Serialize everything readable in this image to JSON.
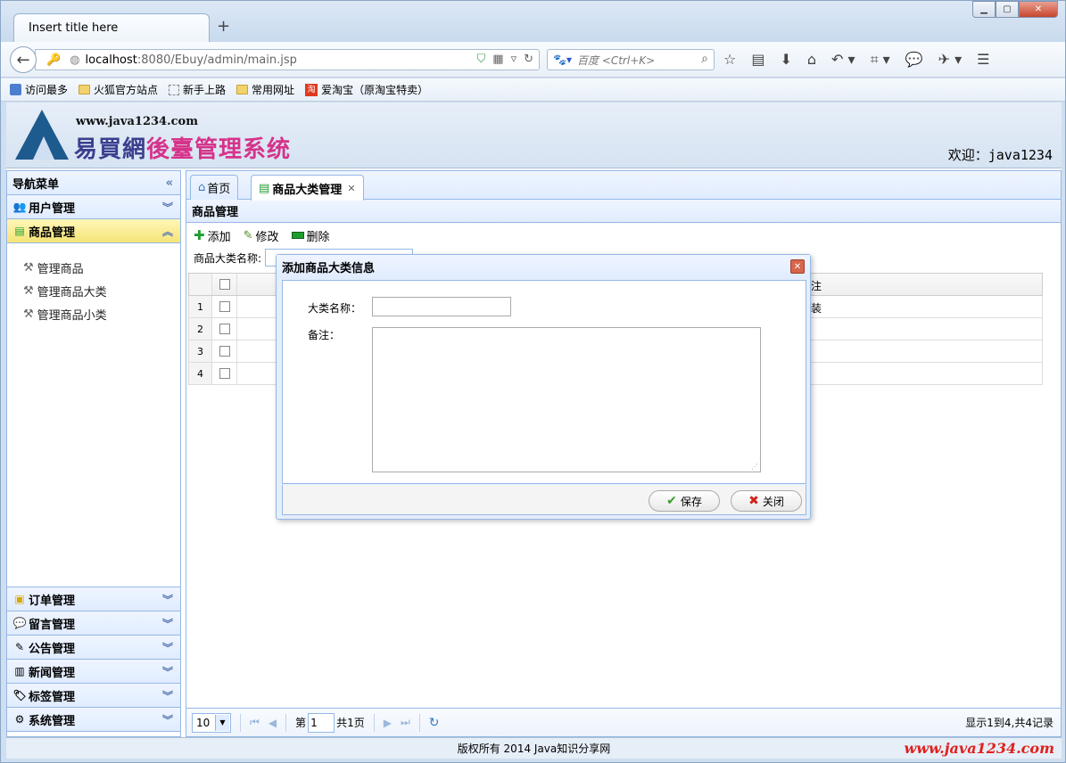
{
  "browser": {
    "tab_title": "Insert title here",
    "new_tab": "+",
    "url_host": "localhost",
    "url_path": ":8080/Ebuy/admin/main.jsp",
    "search_placeholder": "百度 <Ctrl+K>",
    "bookmarks": [
      "访问最多",
      "火狐官方站点",
      "新手上路",
      "常用网址",
      "爱淘宝（原淘宝特卖）"
    ]
  },
  "header": {
    "site_url": "www.java1234.com",
    "title_part1": "易買網",
    "title_part2": "後臺管理系统",
    "welcome": "欢迎：java1234"
  },
  "nav": {
    "title": "导航菜单",
    "sections": [
      {
        "label": "用户管理",
        "icon": "users-icon"
      },
      {
        "label": "商品管理",
        "icon": "list-icon",
        "active": true,
        "items": [
          "管理商品",
          "管理商品大类",
          "管理商品小类"
        ]
      },
      {
        "label": "订单管理",
        "icon": "order-icon"
      },
      {
        "label": "留言管理",
        "icon": "comment-icon"
      },
      {
        "label": "公告管理",
        "icon": "notice-icon"
      },
      {
        "label": "新闻管理",
        "icon": "news-icon"
      },
      {
        "label": "标签管理",
        "icon": "tag-icon"
      },
      {
        "label": "系统管理",
        "icon": "gear-icon"
      }
    ]
  },
  "main": {
    "tabs": [
      {
        "label": "首页",
        "icon": "home-icon"
      },
      {
        "label": "商品大类管理",
        "icon": "list-icon",
        "selected": true
      }
    ],
    "panel_title": "商品管理",
    "toolbar": {
      "add": "添加",
      "edit": "修改",
      "delete": "删除"
    },
    "search_label": "商品大类名称:",
    "grid": {
      "rows": [
        {
          "num": "1",
          "remark": "装"
        },
        {
          "num": "2",
          "remark": ""
        },
        {
          "num": "3",
          "remark": ""
        },
        {
          "num": "4",
          "remark": ""
        }
      ],
      "header_remark": "注"
    },
    "pager": {
      "page_size": "10",
      "page_prefix": "第",
      "page_value": "1",
      "page_suffix": "共1页",
      "info": "显示1到4,共4记录"
    }
  },
  "dialog": {
    "title": "添加商品大类信息",
    "name_label": "大类名称：",
    "remark_label": "备注：",
    "save": "保存",
    "close": "关闭"
  },
  "footer": {
    "copyright": "版权所有 2014 Java知识分享网",
    "watermark": "www.java1234.com"
  }
}
